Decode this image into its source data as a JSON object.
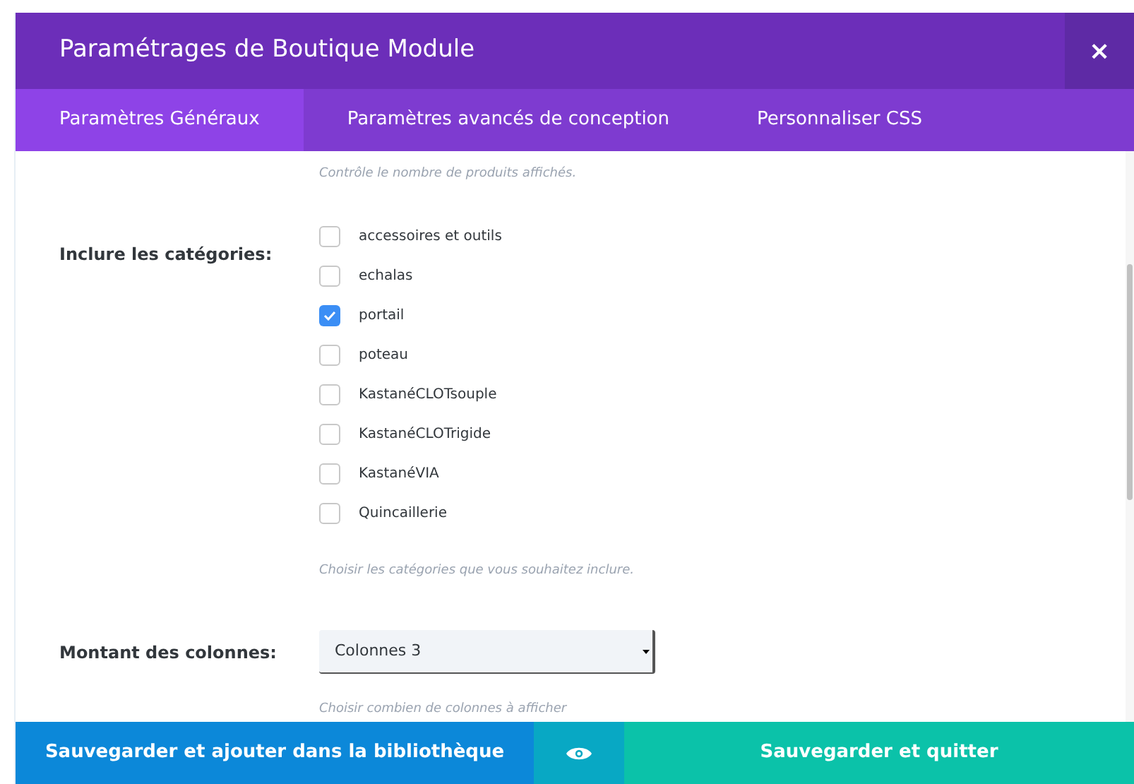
{
  "window": {
    "title": "Paramétrages de Boutique Module",
    "close": "×"
  },
  "tabs": [
    {
      "label": "Paramètres Généraux",
      "selected": true
    },
    {
      "label": "Paramètres avancés de conception",
      "selected": false
    },
    {
      "label": "Personnaliser CSS",
      "selected": false
    }
  ],
  "top_hint": "Contrôle le nombre de produits affichés.",
  "categories": {
    "label": "Inclure les catégories:",
    "items": [
      {
        "label": "accessoires et outils",
        "checked": false
      },
      {
        "label": "echalas",
        "checked": false
      },
      {
        "label": "portail",
        "checked": true
      },
      {
        "label": "poteau",
        "checked": false
      },
      {
        "label": "KastanéCLOTsouple",
        "checked": false
      },
      {
        "label": "KastanéCLOTrigide",
        "checked": false
      },
      {
        "label": "KastanéVIA",
        "checked": false
      },
      {
        "label": "Quincaillerie",
        "checked": false
      }
    ],
    "hint": "Choisir les catégories que vous souhaitez inclure."
  },
  "columns": {
    "label": "Montant des colonnes:",
    "value": "Colonnes 3",
    "hint": "Choisir combien de colonnes à afficher"
  },
  "footer": {
    "save_library": "Sauvegarder et ajouter dans la bibliothèque",
    "save_quit": "Sauvegarder et quitter"
  }
}
